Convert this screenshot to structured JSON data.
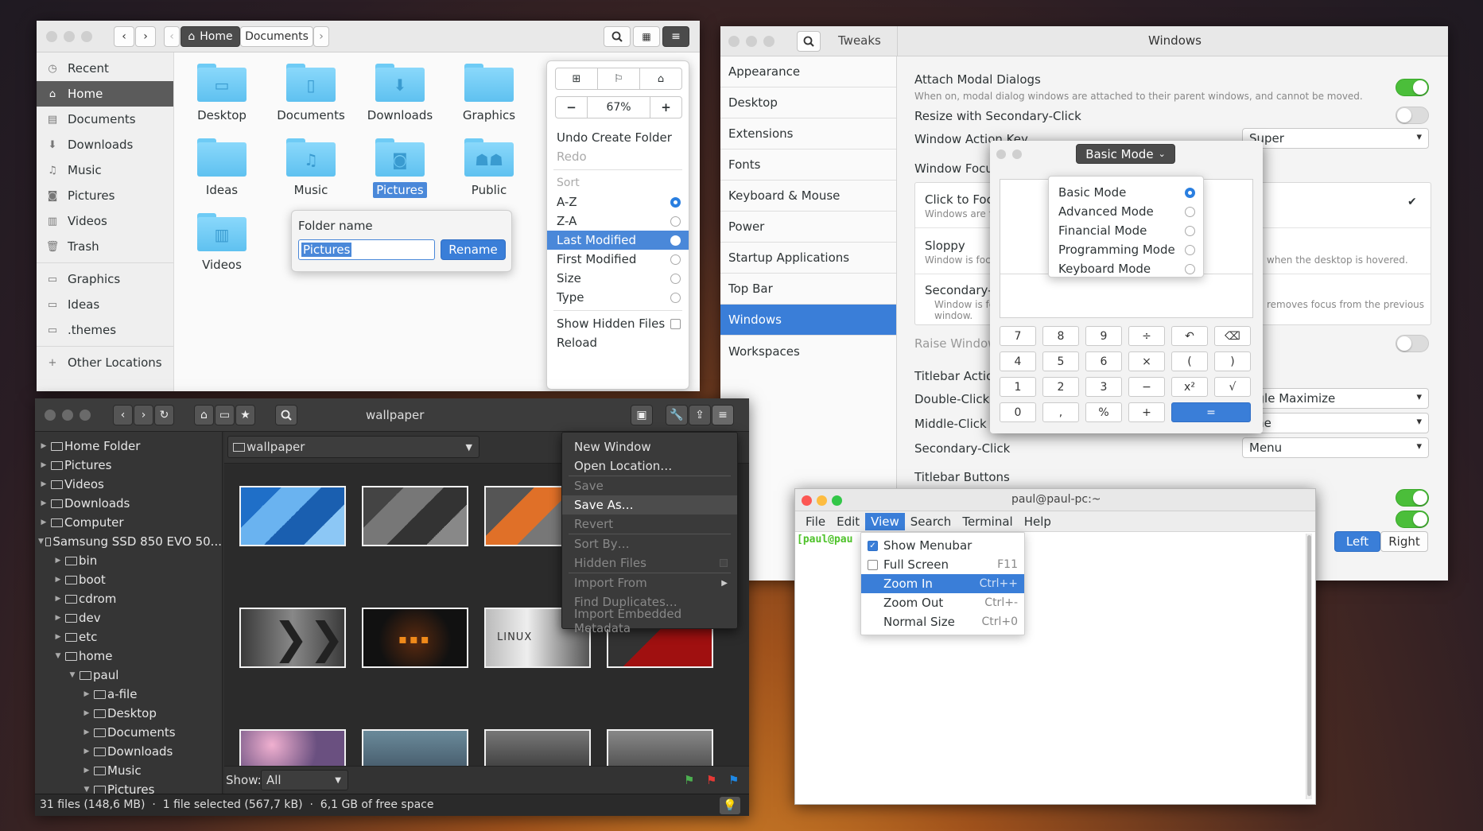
{
  "files": {
    "breadcrumb": [
      "Home",
      "Documents"
    ],
    "sidebar": [
      "Recent",
      "Home",
      "Documents",
      "Downloads",
      "Music",
      "Pictures",
      "Videos",
      "Trash",
      "Graphics",
      "Ideas",
      ".themes",
      "Other Locations"
    ],
    "folders": [
      "Desktop",
      "Documents",
      "Downloads",
      "Graphics",
      "Ideas",
      "Music",
      "Pictures",
      "Public",
      "Videos"
    ],
    "rename": {
      "label": "Folder name",
      "value": "Pictures",
      "button": "Rename"
    },
    "menu": {
      "zoom": "67%",
      "undo": "Undo Create Folder",
      "redo": "Redo",
      "sort_header": "Sort",
      "sort_items": [
        "A-Z",
        "Z-A",
        "Last Modified",
        "First Modified",
        "Size",
        "Type"
      ],
      "show_hidden": "Show Hidden Files",
      "reload": "Reload"
    }
  },
  "tweaks": {
    "app": "Tweaks",
    "title": "Windows",
    "sidebar": [
      "Appearance",
      "Desktop",
      "Extensions",
      "Fonts",
      "Keyboard & Mouse",
      "Power",
      "Startup Applications",
      "Top Bar",
      "Windows",
      "Workspaces"
    ],
    "attach_modal": "Attach Modal Dialogs",
    "attach_modal_desc": "When on, modal dialog windows are attached to their parent windows, and cannot be moved.",
    "resize_secondary": "Resize with Secondary-Click",
    "action_key": "Window Action Key",
    "action_key_value": "Super",
    "focus_header": "Window Focus",
    "click_focus": "Click to Focus",
    "click_focus_desc": "Windows are f",
    "sloppy": "Sloppy",
    "sloppy_desc": "Window is focu",
    "sloppy_desc2": "when the desktop is hovered.",
    "secondary": "Secondary-C",
    "secondary_desc": "Window is fo",
    "secondary_desc_b": "window.",
    "secondary_desc2": "removes focus from the previous",
    "raise": "Raise Window",
    "titlebar_actions": "Titlebar Actions",
    "double_click": "Double-Click",
    "double_click_value": "ggle Maximize",
    "middle_click": "Middle-Click",
    "middle_click_value": "one",
    "secondary_click": "Secondary-Click",
    "secondary_click_value": "Menu",
    "titlebar_buttons": "Titlebar Buttons",
    "placement_left": "Left",
    "placement_right": "Right"
  },
  "calculator": {
    "mode": "Basic Mode",
    "modes": [
      "Basic Mode",
      "Advanced Mode",
      "Financial Mode",
      "Programming Mode",
      "Keyboard Mode"
    ],
    "keys": [
      "7",
      "8",
      "9",
      "÷",
      "↶",
      "⌫",
      "4",
      "5",
      "6",
      "×",
      "(",
      ")",
      "1",
      "2",
      "3",
      "−",
      "x²",
      "√",
      "0",
      ",",
      "%",
      "+",
      "="
    ]
  },
  "shotwell": {
    "title": "wallpaper",
    "path": "wallpaper",
    "tree": [
      "Home Folder",
      "Pictures",
      "Videos",
      "Downloads",
      "Computer",
      "Samsung SSD 850 EVO 50...",
      "bin",
      "boot",
      "cdrom",
      "dev",
      "etc",
      "home",
      "paul",
      "a-file",
      "Desktop",
      "Documents",
      "Downloads",
      "Music",
      "Pictures"
    ],
    "menu": [
      "New Window",
      "Open Location…",
      "Save",
      "Save As…",
      "Revert",
      "Sort By…",
      "Hidden Files",
      "Import From",
      "Find Duplicates…",
      "Import Embedded Metadata"
    ],
    "thumb_label": "LINUX",
    "show_label": "Show:",
    "show_value": "All",
    "status": "31 files (148,6 MB)  ·  1 file selected (567,7 kB)  ·  6,1 GB of free space"
  },
  "terminal": {
    "title": "paul@paul-pc:~",
    "menubar": [
      "File",
      "Edit",
      "View",
      "Search",
      "Terminal",
      "Help"
    ],
    "prompt": "[paul@pau",
    "menu": [
      {
        "label": "Show Menubar",
        "accel": ""
      },
      {
        "label": "Full Screen",
        "accel": "F11"
      },
      {
        "label": "Zoom In",
        "accel": "Ctrl++"
      },
      {
        "label": "Zoom Out",
        "accel": "Ctrl+-"
      },
      {
        "label": "Normal Size",
        "accel": "Ctrl+0"
      }
    ]
  },
  "colors": {
    "accent": "#3a7ed8",
    "toggle_on": "#4bbe3a",
    "folder": "#6ecbf5",
    "dark_bg": "#2f2f2f"
  }
}
